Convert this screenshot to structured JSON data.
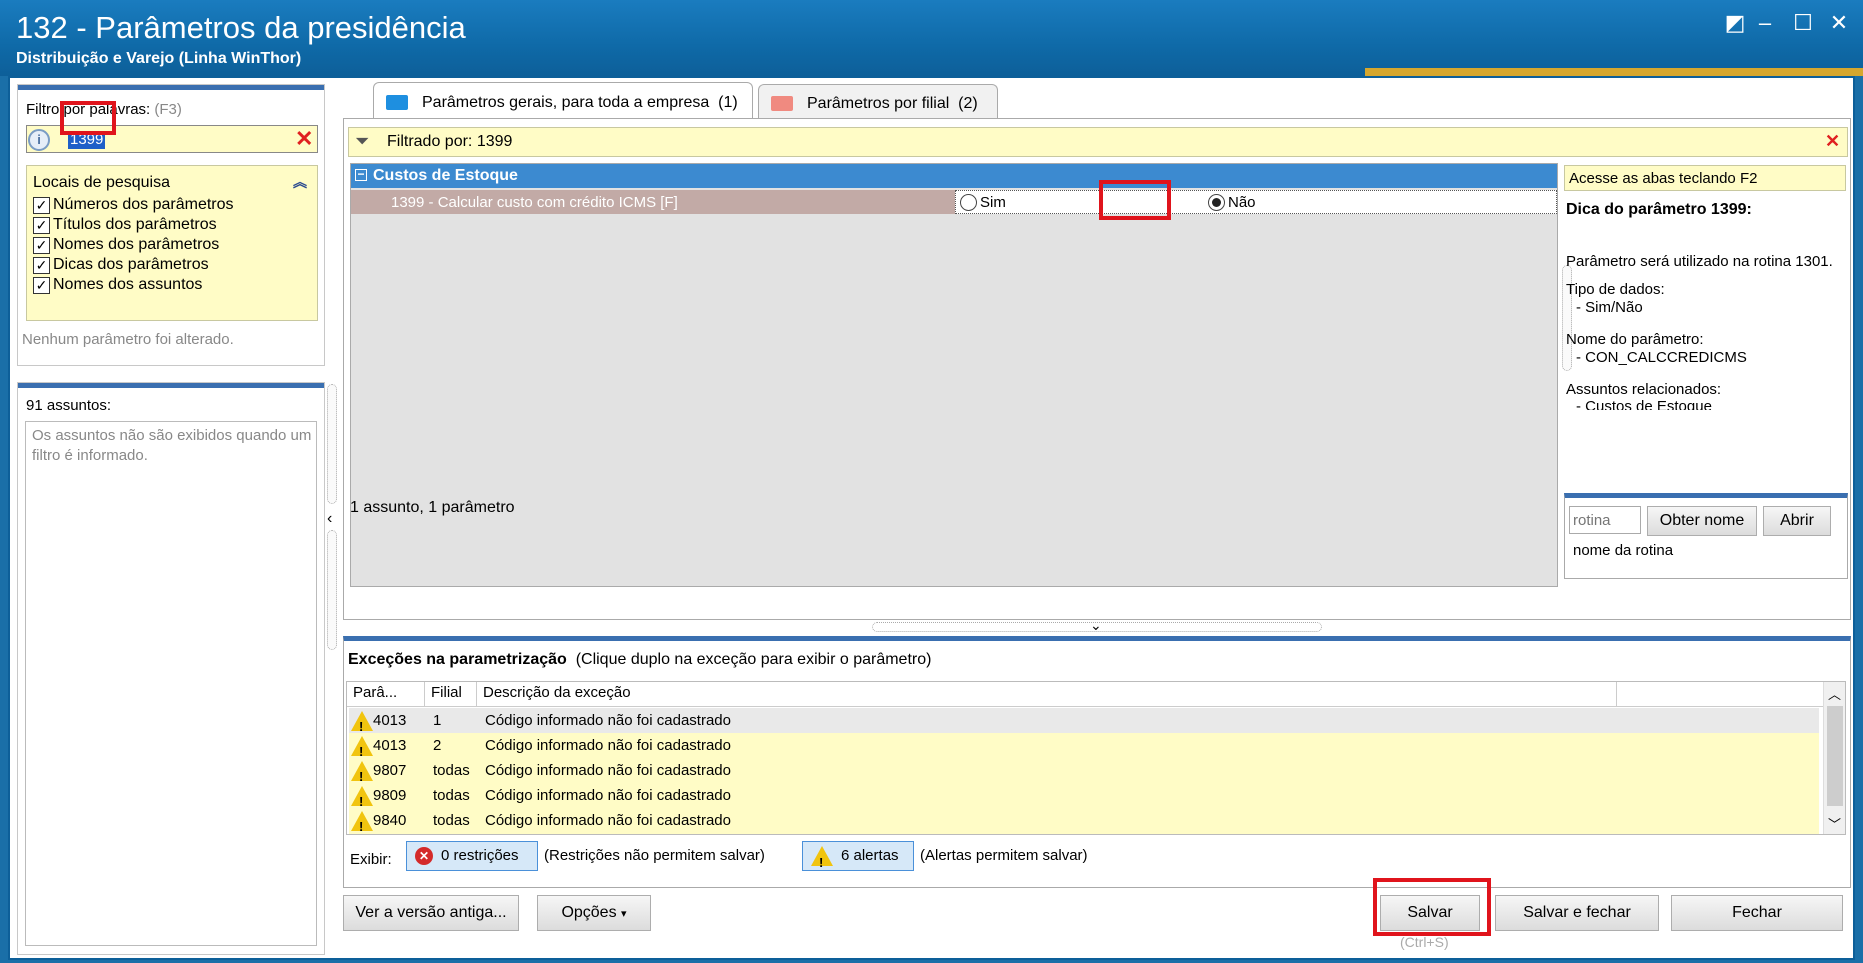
{
  "window": {
    "title": "132 - Parâmetros da presidência",
    "subtitle": "Distribuição e Varejo (Linha WinThor)"
  },
  "filter": {
    "label": "Filtro por palavras:",
    "shortcut": "(F3)",
    "value": "1399",
    "locations_title": "Locais de pesquisa",
    "locations": [
      "Números dos parâmetros",
      "Títulos dos parâmetros",
      "Nomes dos parâmetros",
      "Dicas dos parâmetros",
      "Nomes dos assuntos"
    ],
    "status": "Nenhum parâmetro foi alterado."
  },
  "subjects": {
    "count_label": "91 assuntos:",
    "note": "Os assuntos não são exibidos quando um filtro é informado."
  },
  "tabs": [
    {
      "label": "Parâmetros gerais, para toda a empresa",
      "count": "(1)"
    },
    {
      "label": "Parâmetros por filial",
      "count": "(2)"
    }
  ],
  "grid": {
    "filtered_by": "Filtrado por: 1399",
    "group": "Custos de Estoque",
    "param_label": "1399 - Calcular custo com crédito ICMS [F]",
    "option_yes": "Sim",
    "option_no": "Não",
    "selected": "Não",
    "summary": "1 assunto, 1 parâmetro"
  },
  "hint": {
    "tabs_tip": "Acesse as abas teclando F2",
    "title": "Dica do parâmetro 1399:",
    "usage": "Parâmetro será utilizado na rotina 1301.",
    "type_label": "Tipo de dados:",
    "type_value": "- Sim/Não",
    "name_label": "Nome do parâmetro:",
    "name_value": "- CON_CALCCREDICMS",
    "related_label": "Assuntos relacionados:",
    "related_value": "- Custos de Estoque",
    "rotina_placeholder": "rotina",
    "obter_nome": "Obter nome",
    "abrir": "Abrir",
    "rotina_name": "nome da rotina"
  },
  "exceptions": {
    "title": "Exceções na parametrização",
    "subtitle": "(Clique duplo na exceção para exibir o parâmetro)",
    "columns": [
      "Parâ...",
      "Filial",
      "Descrição da exceção"
    ],
    "rows": [
      {
        "param": "4013",
        "filial": "1",
        "desc": "Código informado não foi cadastrado"
      },
      {
        "param": "4013",
        "filial": "2",
        "desc": "Código informado não foi cadastrado"
      },
      {
        "param": "9807",
        "filial": "todas",
        "desc": "Código informado não foi cadastrado"
      },
      {
        "param": "9809",
        "filial": "todas",
        "desc": "Código informado não foi cadastrado"
      },
      {
        "param": "9840",
        "filial": "todas",
        "desc": "Código informado não foi cadastrado"
      }
    ],
    "show_label": "Exibir:",
    "restrictions": "0 restrições",
    "restrictions_note": "(Restrições não permitem salvar)",
    "alerts": "6 alertas",
    "alerts_note": "(Alertas permitem salvar)"
  },
  "footer": {
    "old_version": "Ver a versão antiga...",
    "options": "Opções",
    "save": "Salvar",
    "save_shortcut": "(Ctrl+S)",
    "save_close": "Salvar e fechar",
    "close": "Fechar"
  },
  "colors": {
    "titlebar": "#1a7cbf",
    "group_header": "#3c8ad0",
    "highlight_box": "#e0141c",
    "hint_yellow": "#fffcc6"
  }
}
